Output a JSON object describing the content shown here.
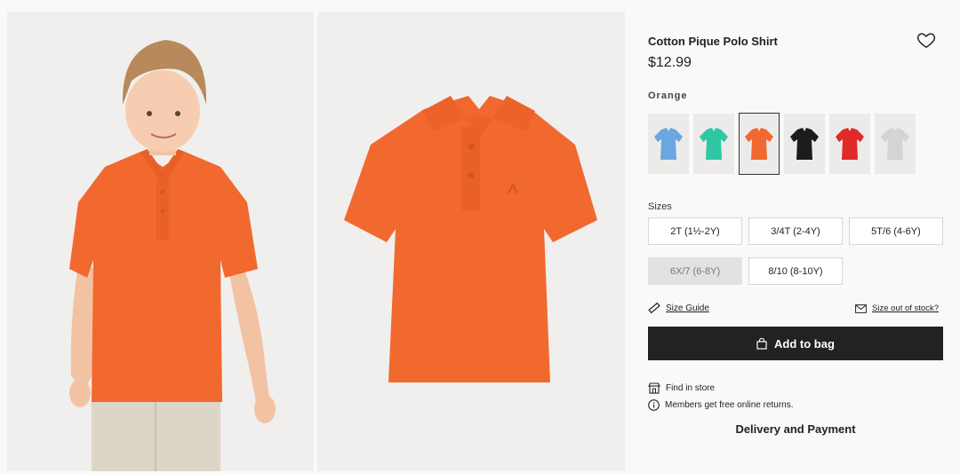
{
  "product": {
    "title": "Cotton Pique Polo Shirt",
    "price": "$12.99",
    "color_label": "Orange",
    "main_color": "#f2692f"
  },
  "swatches": [
    {
      "name": "blue",
      "color": "#6aa7e0"
    },
    {
      "name": "turquoise",
      "color": "#2fc7a3"
    },
    {
      "name": "orange",
      "color": "#f2692f",
      "selected": true
    },
    {
      "name": "black",
      "color": "#1c1c1c"
    },
    {
      "name": "red",
      "color": "#e02a2a"
    },
    {
      "name": "light-grey",
      "color": "#d4d4d4"
    }
  ],
  "sizes": {
    "label": "Sizes",
    "options": [
      {
        "label": "2T (1½-2Y)",
        "available": true
      },
      {
        "label": "3/4T (2-4Y)",
        "available": true
      },
      {
        "label": "5T/6 (4-6Y)",
        "available": true
      },
      {
        "label": "6X/7 (6-8Y)",
        "available": false
      },
      {
        "label": "8/10 (8-10Y)",
        "available": true
      }
    ]
  },
  "links": {
    "size_guide": "Size Guide",
    "size_out_of_stock": "Size out of stock?"
  },
  "actions": {
    "add_to_bag": "Add to bag"
  },
  "info": {
    "find_in_store": "Find in store",
    "free_returns": "Members get free online returns."
  },
  "footer": {
    "delivery": "Delivery and Payment"
  },
  "icons": {
    "wishlist": "heart-icon",
    "size_guide": "ruler-icon",
    "stock": "mail-icon",
    "bag": "bag-icon",
    "store": "store-icon",
    "info": "info-icon"
  }
}
